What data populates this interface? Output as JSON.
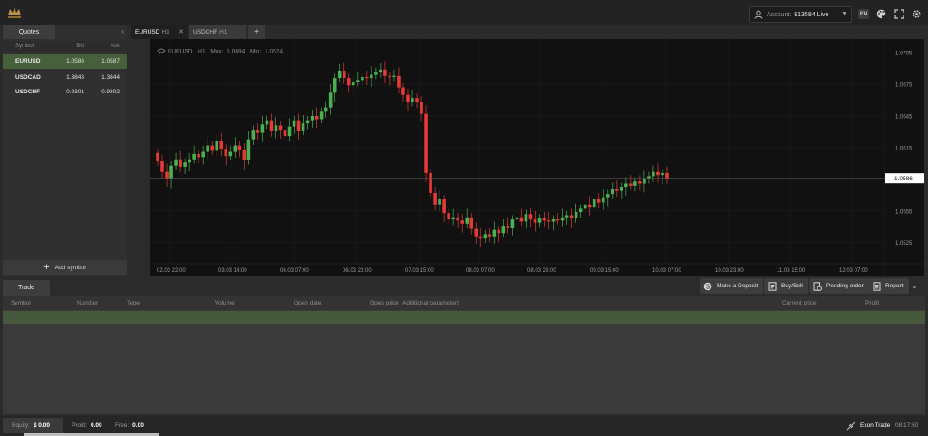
{
  "header": {
    "account_label": "Account:",
    "account_value": "813584 Live",
    "lang": "EN"
  },
  "quotes": {
    "tab": "Quotes",
    "columns": {
      "symbol": "Symbol",
      "bid": "Bid",
      "ask": "Ask"
    },
    "rows": [
      {
        "symbol": "EURUSD",
        "bid": "1.0586",
        "ask": "1.0587",
        "active": true
      },
      {
        "symbol": "USDCAD",
        "bid": "1.3843",
        "ask": "1.3844",
        "active": false
      },
      {
        "symbol": "USDCHF",
        "bid": "0.9301",
        "ask": "0.9302",
        "active": false
      }
    ],
    "add_symbol": "Add symbol"
  },
  "chart_tabs": [
    {
      "symbol": "EURUSD",
      "tf": "H1",
      "active": true
    },
    {
      "symbol": "USDCHF",
      "tf": "H1",
      "active": false
    }
  ],
  "chart_data": {
    "type": "candlestick",
    "info_symbol": "EURUSD",
    "info_tf": "H1",
    "info_max_label": "Max:",
    "info_max": "1.0694",
    "info_min_label": "Min:",
    "info_min": "1.0524",
    "current_price_label": "1.0586",
    "ylim": [
      1.0505,
      1.0718
    ],
    "y_ticks": [
      "1.0705",
      "1.0675",
      "1.0645",
      "1.0615",
      "1.0555",
      "1.0525"
    ],
    "x_ticks": [
      "02.03 22:00",
      "03.03 14:00",
      "06.03 07:00",
      "06.03 23:00",
      "07.03 15:00",
      "08.03 07:00",
      "08.03 23:00",
      "09.03 15:00",
      "10.03 07:00",
      "10.03 23:00",
      "11.03 15:00",
      "12.03 07:00"
    ],
    "up_color": "#4caf50",
    "down_color": "#e53935",
    "close_series": [
      1.0602,
      1.0592,
      1.0585,
      1.0598,
      1.0604,
      1.0597,
      1.0601,
      1.0604,
      1.0609,
      1.0606,
      1.0611,
      1.0617,
      1.0612,
      1.0621,
      1.0614,
      1.0607,
      1.0611,
      1.0617,
      1.0613,
      1.0603,
      1.0623,
      1.0632,
      1.0629,
      1.0637,
      1.0641,
      1.0631,
      1.0636,
      1.0632,
      1.0626,
      1.0635,
      1.0641,
      1.0631,
      1.0638,
      1.0641,
      1.0645,
      1.0642,
      1.0649,
      1.0653,
      1.0667,
      1.0681,
      1.0688,
      1.0681,
      1.0674,
      1.0677,
      1.0679,
      1.0682,
      1.0681,
      1.0684,
      1.0687,
      1.0689,
      1.0683,
      1.0682,
      1.0683,
      1.0672,
      1.0665,
      1.0658,
      1.0662,
      1.0658,
      1.0647,
      1.0591,
      1.0572,
      1.0561,
      1.0566,
      1.0553,
      1.0547,
      1.0549,
      1.0546,
      1.0543,
      1.0549,
      1.0538,
      1.0531,
      1.0529,
      1.0533,
      1.0531,
      1.0537,
      1.0534,
      1.0541,
      1.0539,
      1.0547,
      1.0549,
      1.0545,
      1.0552,
      1.0547,
      1.0544,
      1.0548,
      1.0546,
      1.0545,
      1.0547,
      1.0546,
      1.0549,
      1.0551,
      1.0548,
      1.0554,
      1.0557,
      1.0561,
      1.0559,
      1.0566,
      1.0563,
      1.0568,
      1.0571,
      1.0576,
      1.0574,
      1.0578,
      1.0581,
      1.0579,
      1.0583,
      1.0581,
      1.0585,
      1.0588,
      1.0592,
      1.0589,
      1.0591,
      1.0585
    ],
    "x_range": [
      "02.03 22:00",
      "10.03 07:00"
    ]
  },
  "trade": {
    "tab": "Trade",
    "buttons": {
      "deposit": "Make a Deposit",
      "buysell": "Buy/Sell",
      "pending": "Pending order",
      "report": "Report"
    },
    "columns": [
      "Symbol",
      "Number",
      "Type",
      "Volume",
      "Open date",
      "Open price",
      "Additional parameters",
      "Current price",
      "Profit"
    ]
  },
  "footer": {
    "equity_label": "Equity:",
    "equity_value": "$ 0.00",
    "profit_label": "Profit:",
    "profit_value": "0.00",
    "free_label": "Free:",
    "free_value": "0.00",
    "brand": "Exon Trade",
    "time": "08:17:50"
  }
}
